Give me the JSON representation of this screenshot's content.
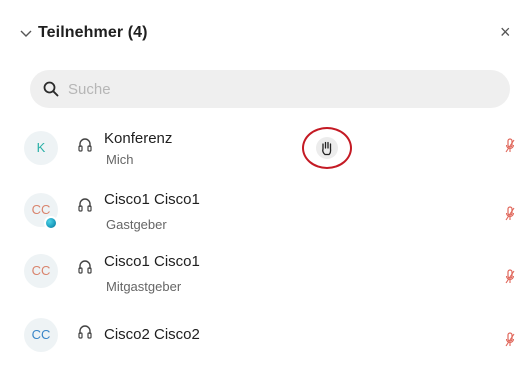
{
  "panel": {
    "title": "Teilnehmer (4)",
    "close_glyph": "×"
  },
  "search": {
    "placeholder": "Suche",
    "value": ""
  },
  "participants": [
    {
      "initials": "K",
      "name": "Konferenz",
      "role": "Mich",
      "avatar_color": "#2ab0a7",
      "presence": false,
      "raised_hand": true
    },
    {
      "initials": "CC",
      "name": "Cisco1 Cisco1",
      "role": "Gastgeber",
      "avatar_color": "#d9846d",
      "presence": true,
      "raised_hand": false
    },
    {
      "initials": "CC",
      "name": "Cisco1 Cisco1",
      "role": "Mitgastgeber",
      "avatar_color": "#d9846d",
      "presence": false,
      "raised_hand": false
    },
    {
      "initials": "CC",
      "name": "Cisco2 Cisco2",
      "role": "",
      "avatar_color": "#3a86c8",
      "presence": false,
      "raised_hand": false
    }
  ],
  "icons": {
    "collapse": "chevron-down-icon",
    "close": "close-icon",
    "search": "search-icon",
    "audio": "headset-icon",
    "muted": "mic-muted-icon",
    "raise_hand": "raised-hand-icon"
  },
  "colors": {
    "muted_mic": "#e0665a",
    "hand_highlight": "#c41a24",
    "search_bg": "#efefef"
  }
}
